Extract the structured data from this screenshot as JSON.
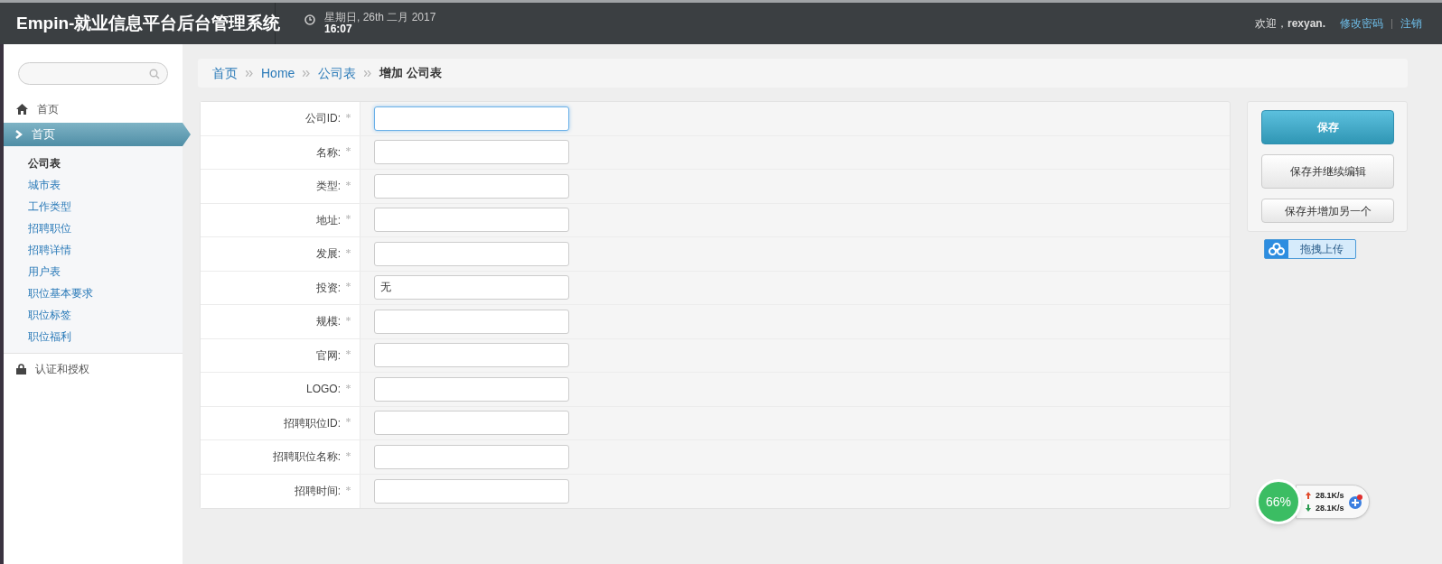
{
  "header": {
    "title": "Empin-就业信息平台后台管理系统",
    "date": "星期日, 26th 二月 2017",
    "time": "16:07",
    "welcome": "欢迎，**rexyan.**",
    "links": [
      "修改密码",
      "注销"
    ]
  },
  "sidebar": {
    "items": [
      {
        "kind": "home",
        "label": "首页",
        "selected": false
      },
      {
        "kind": "section",
        "label": "首页",
        "selected": true,
        "children": [
          {
            "label": "公司表",
            "selected": true
          },
          {
            "label": "城市表",
            "selected": false
          },
          {
            "label": "工作类型",
            "selected": false
          },
          {
            "label": "招聘职位",
            "selected": false
          },
          {
            "label": "招聘详情",
            "selected": false
          },
          {
            "label": "用户表",
            "selected": false
          },
          {
            "label": "职位基本要求",
            "selected": false
          },
          {
            "label": "职位标签",
            "selected": false
          },
          {
            "label": "职位福利",
            "selected": false
          }
        ]
      },
      {
        "kind": "lock",
        "label": "认证和授权",
        "selected": false
      }
    ]
  },
  "breadcrumb": [
    {
      "label": "首页",
      "current": false
    },
    {
      "label": "Home",
      "current": false
    },
    {
      "label": "公司表",
      "current": false
    },
    {
      "label": "增加 公司表",
      "current": true
    }
  ],
  "form": {
    "fields": [
      {
        "label": "公司ID:",
        "required": true,
        "focused": true
      },
      {
        "label": "名称:",
        "required": true,
        "focused": false
      },
      {
        "label": "类型:",
        "required": true,
        "focused": false
      },
      {
        "label": "地址:",
        "required": true,
        "focused": false
      },
      {
        "label": "发展:",
        "required": true,
        "focused": false
      },
      {
        "label": "投资:",
        "required": true,
        "focused": false,
        "value": "无"
      },
      {
        "label": "规模:",
        "required": true,
        "focused": false
      },
      {
        "label": "官网:",
        "required": true,
        "focused": false
      },
      {
        "label": "LOGO:",
        "required": true,
        "focused": false
      },
      {
        "label": "招聘职位ID:",
        "required": true,
        "focused": false
      },
      {
        "label": "招聘职位名称:",
        "required": true,
        "focused": false
      },
      {
        "label": "招聘时间:",
        "required": true,
        "focused": false
      }
    ]
  },
  "actions": [
    {
      "label": "保存",
      "kind": "primary"
    },
    {
      "label": "保存并继续编辑",
      "kind": "default"
    },
    {
      "label": "保存并增加另一个",
      "kind": "default"
    }
  ],
  "upload": {
    "label": "拖拽上传"
  },
  "net_widget": {
    "percent": "66%",
    "upload": "28.1K/s",
    "download": "28.1K/s"
  }
}
